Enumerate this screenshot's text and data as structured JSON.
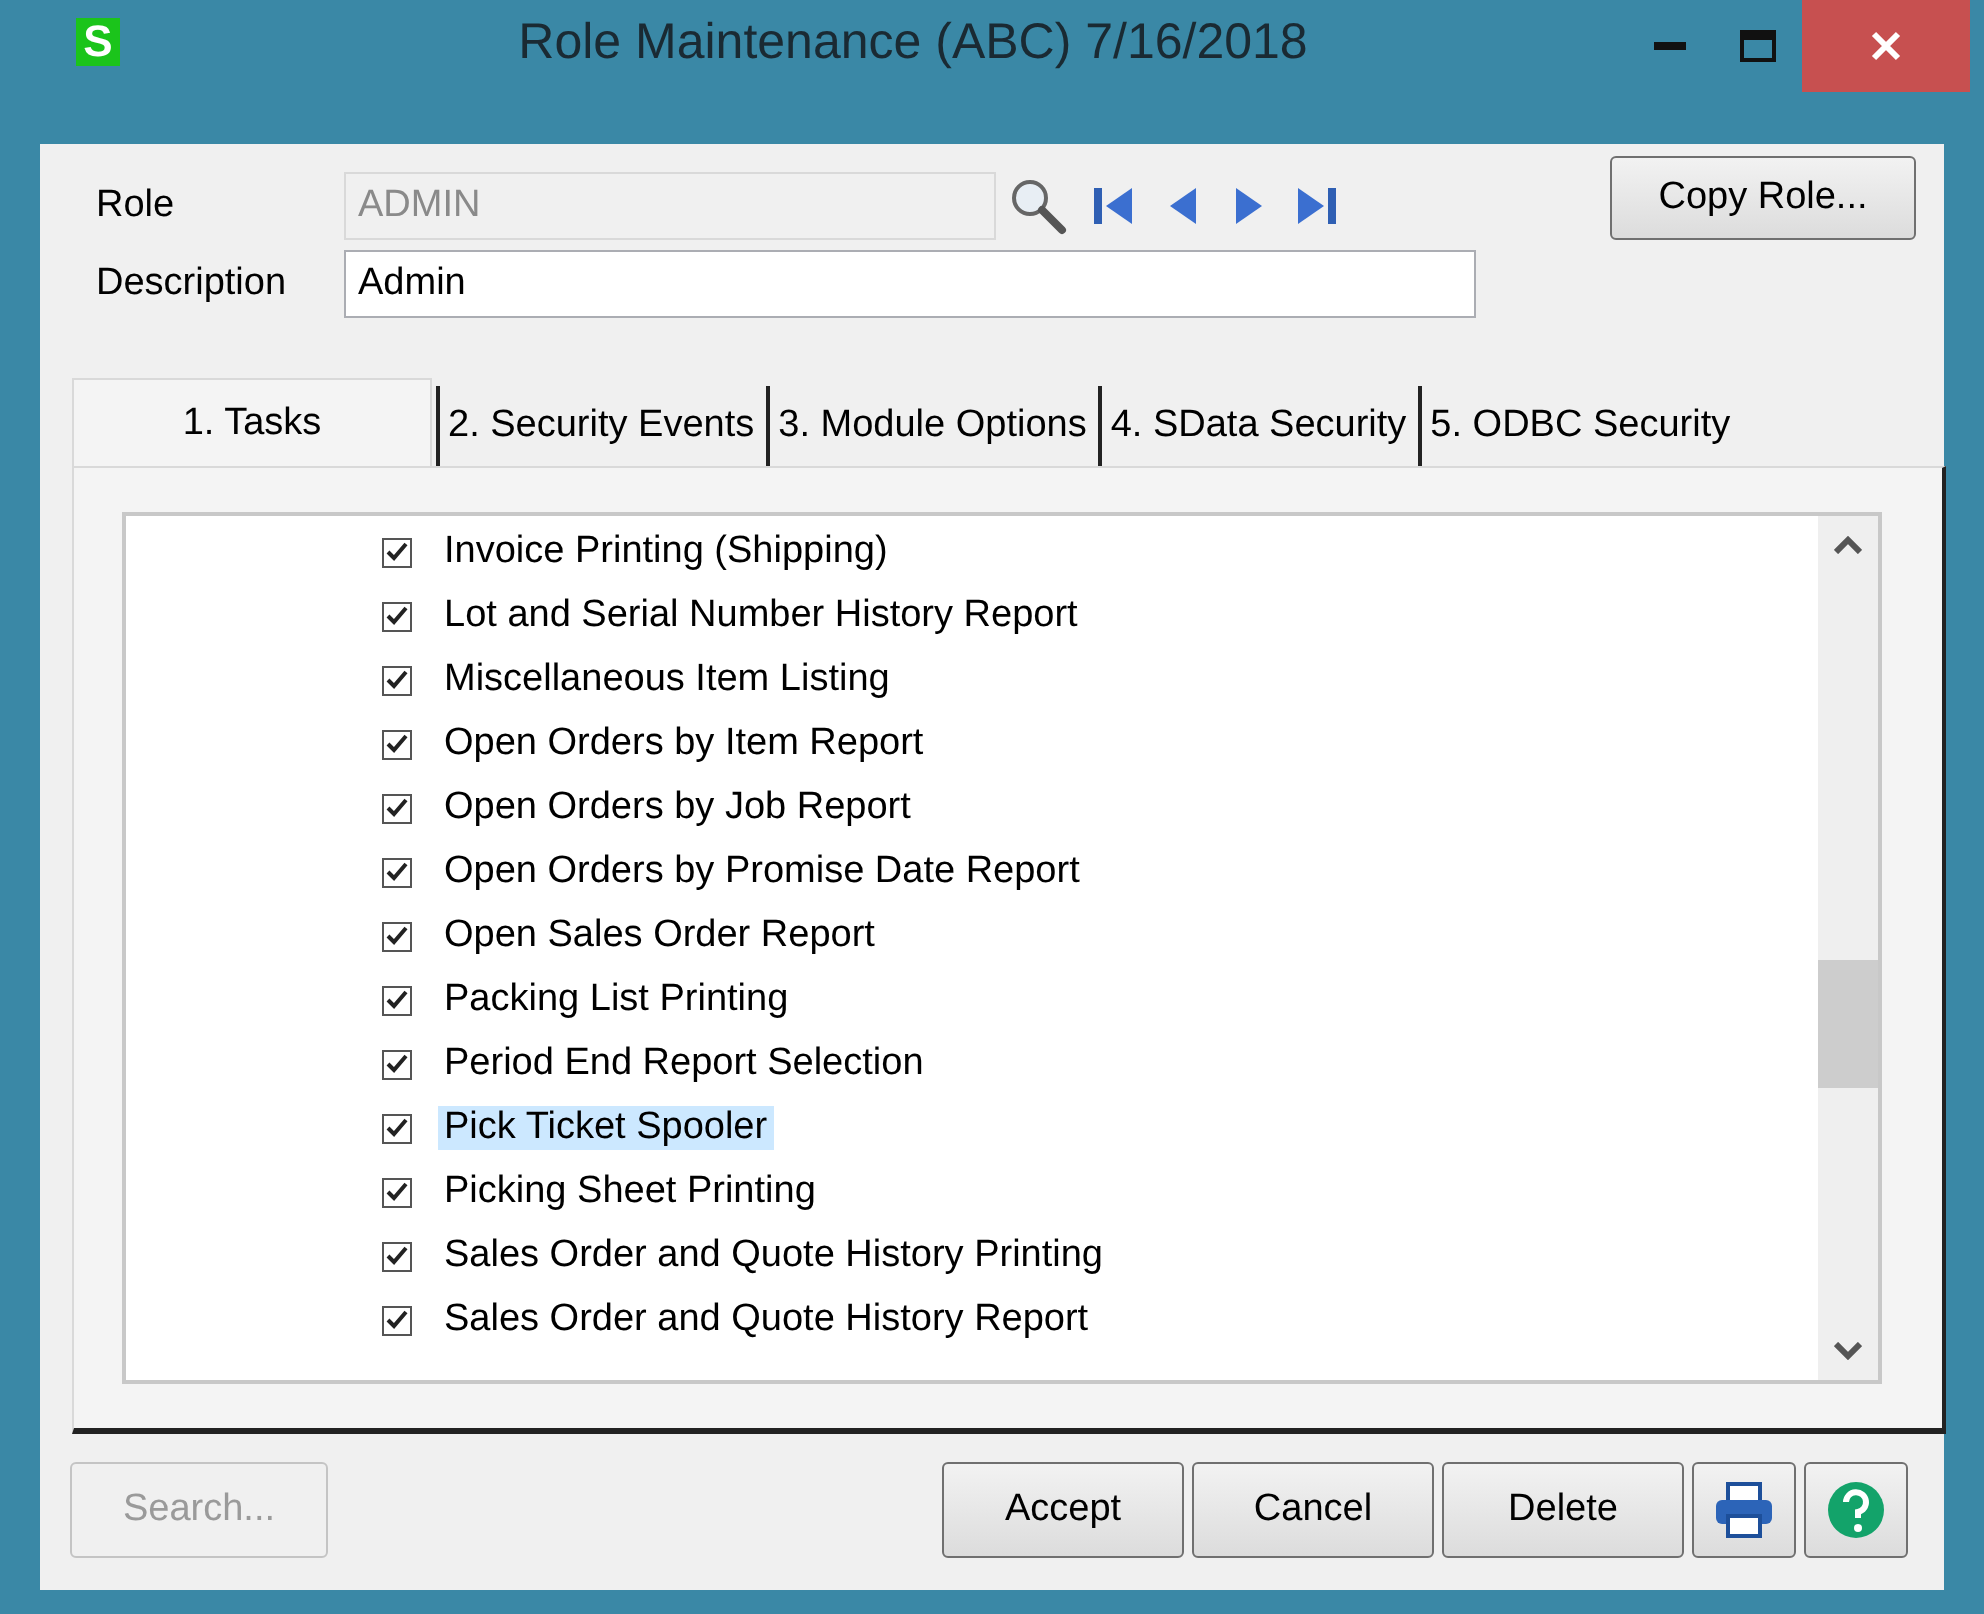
{
  "window": {
    "title": "Role Maintenance (ABC) 7/16/2018",
    "app_icon": "S"
  },
  "role": {
    "label": "Role",
    "value": "ADMIN",
    "disabled": true
  },
  "description": {
    "label": "Description",
    "value": "Admin"
  },
  "copy_button": "Copy Role...",
  "tabs": [
    {
      "label": "1. Tasks",
      "selected": true
    },
    {
      "label": "2. Security Events",
      "selected": false
    },
    {
      "label": "3. Module Options",
      "selected": false
    },
    {
      "label": "4. SData Security",
      "selected": false
    },
    {
      "label": "5. ODBC Security",
      "selected": false
    }
  ],
  "tasks": [
    {
      "label": "Invoice Printing (Shipping)",
      "checked": true,
      "selected": false
    },
    {
      "label": "Lot and Serial Number History Report",
      "checked": true,
      "selected": false
    },
    {
      "label": "Miscellaneous Item Listing",
      "checked": true,
      "selected": false
    },
    {
      "label": "Open Orders by Item Report",
      "checked": true,
      "selected": false
    },
    {
      "label": "Open Orders by Job Report",
      "checked": true,
      "selected": false
    },
    {
      "label": "Open Orders by Promise Date Report",
      "checked": true,
      "selected": false
    },
    {
      "label": "Open Sales Order Report",
      "checked": true,
      "selected": false
    },
    {
      "label": "Packing List Printing",
      "checked": true,
      "selected": false
    },
    {
      "label": "Period End Report Selection",
      "checked": true,
      "selected": false
    },
    {
      "label": "Pick Ticket Spooler",
      "checked": true,
      "selected": true
    },
    {
      "label": "Picking Sheet Printing",
      "checked": true,
      "selected": false
    },
    {
      "label": "Sales Order and Quote History Printing",
      "checked": true,
      "selected": false
    },
    {
      "label": "Sales Order and Quote History Report",
      "checked": true,
      "selected": false
    }
  ],
  "buttons": [
    {
      "label": "Search...",
      "disabled": true
    },
    {
      "label": "Accept",
      "disabled": false
    },
    {
      "label": "Cancel",
      "disabled": false
    },
    {
      "label": "Delete",
      "disabled": false
    }
  ]
}
